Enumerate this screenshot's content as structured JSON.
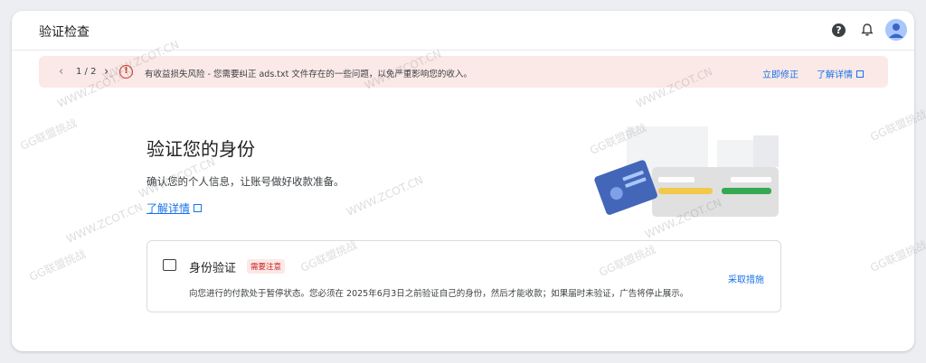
{
  "header": {
    "title": "验证检查"
  },
  "icons": {
    "help": "help-icon",
    "bell": "bell-icon",
    "avatar": "avatar"
  },
  "alert": {
    "pager": "1 / 2",
    "message": "有收益损失风险 - 您需要纠正 ads.txt 文件存在的一些问题，以免严重影响您的收入。",
    "fix_label": "立即修正",
    "learn_label": "了解详情"
  },
  "main": {
    "heading": "验证您的身份",
    "subtext": "确认您的个人信息，让账号做好收款准备。",
    "learn_link": "了解详情"
  },
  "verification": {
    "title": "身份验证",
    "badge": "需要注意",
    "description": "向您进行的付款处于暂停状态。您必须在 2025年6月3日之前验证自己的身份，然后才能收款；如果届时未验证，广告将停止展示。",
    "action": "采取措施"
  },
  "watermarks": [
    "GG联盟挑战",
    "WWW.ZCOT.CN"
  ],
  "colors": {
    "accent": "#1a73e8",
    "alert_bg": "#fbe9e7",
    "error": "#d93025"
  }
}
